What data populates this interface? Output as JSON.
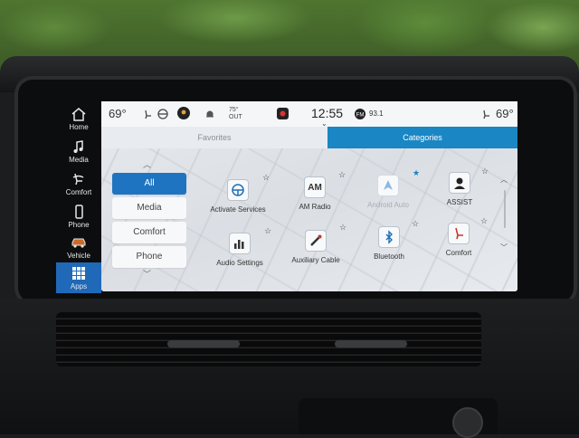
{
  "colors": {
    "accent": "#1a86c4",
    "nav_active": "#1f69b8",
    "filter_active": "#1f74c2"
  },
  "status": {
    "left_temp": "69°",
    "out_temp": "75°",
    "out_label": "OUT",
    "time": "12:55",
    "radio_station": "93.1",
    "right_temp": "69°"
  },
  "nav": [
    {
      "label": "Home",
      "icon": "home-icon"
    },
    {
      "label": "Media",
      "icon": "music-note-icon"
    },
    {
      "label": "Comfort",
      "icon": "seat-comfort-icon"
    },
    {
      "label": "Phone",
      "icon": "phone-icon"
    },
    {
      "label": "Vehicle",
      "icon": "vehicle-icon"
    },
    {
      "label": "Apps",
      "icon": "apps-grid-icon",
      "active": true
    }
  ],
  "tabs": {
    "favorites": "Favorites",
    "categories": "Categories",
    "active": "categories"
  },
  "filters": [
    {
      "label": "All",
      "active": true
    },
    {
      "label": "Media"
    },
    {
      "label": "Comfort"
    },
    {
      "label": "Phone"
    }
  ],
  "apps": [
    {
      "label": "Activate Services",
      "icon": "steering-wheel-icon",
      "favorite": false
    },
    {
      "label": "AM Radio",
      "icon_text": "AM",
      "favorite": false
    },
    {
      "label": "Android Auto",
      "icon": "android-auto-icon",
      "favorite": true,
      "disabled": true
    },
    {
      "label": "ASSIST",
      "icon": "assist-agent-icon",
      "favorite": false
    },
    {
      "label": "Audio Settings",
      "icon": "equalizer-icon",
      "favorite": false
    },
    {
      "label": "Auxiliary Cable",
      "icon": "aux-cable-icon",
      "favorite": false
    },
    {
      "label": "Bluetooth",
      "icon": "bluetooth-icon",
      "favorite": false
    },
    {
      "label": "Comfort",
      "icon": "comfort-seat-icon",
      "favorite": false
    }
  ]
}
